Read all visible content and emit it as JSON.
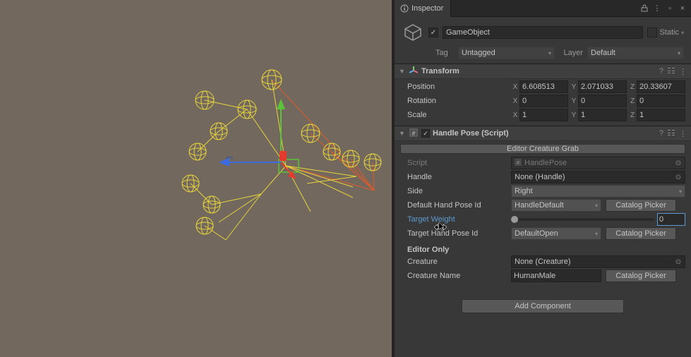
{
  "tab": {
    "title": "Inspector"
  },
  "windowButtons": {
    "lock": "🔒",
    "menu": "⋮",
    "mid": "⊡",
    "close": "×"
  },
  "header": {
    "checked": "✓",
    "name": "GameObject",
    "static_label": "Static"
  },
  "tagLayer": {
    "tag_label": "Tag",
    "tag_value": "Untagged",
    "layer_label": "Layer",
    "layer_value": "Default"
  },
  "transform": {
    "title": "Transform",
    "position": {
      "label": "Position",
      "x": "6.608513",
      "y": "2.071033",
      "z": "20.33607"
    },
    "rotation": {
      "label": "Rotation",
      "x": "0",
      "y": "0",
      "z": "0"
    },
    "scale": {
      "label": "Scale",
      "x": "1",
      "y": "1",
      "z": "1"
    }
  },
  "handlePose": {
    "title": "Handle Pose (Script)",
    "editor_button": "Editor Creature Grab",
    "fields": {
      "script_label": "Script",
      "script_value": "HandlePose",
      "handle_label": "Handle",
      "handle_value": "None (Handle)",
      "side_label": "Side",
      "side_value": "Right",
      "default_hand_label": "Default Hand Pose Id",
      "default_hand_value": "HandleDefault",
      "target_weight_label": "Target Weight",
      "target_weight_value": "0",
      "target_hand_label": "Target Hand Pose Id",
      "target_hand_value": "DefaultOpen",
      "editor_only_label": "Editor Only",
      "creature_label": "Creature",
      "creature_value": "None (Creature)",
      "creature_name_label": "Creature Name",
      "creature_name_value": "HumanMale",
      "catalog_picker": "Catalog Picker"
    }
  },
  "add_component": "Add Component"
}
